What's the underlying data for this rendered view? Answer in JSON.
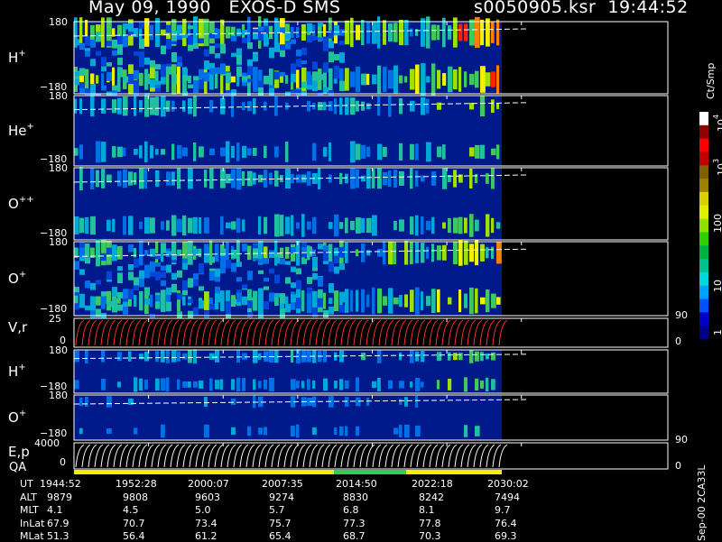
{
  "header": {
    "title": "May 09, 1990   EXOS-D SMS",
    "file": "s0050905.ksr  19:44:52"
  },
  "panels": [
    {
      "name": "h-plus",
      "ion": "H",
      "charge": "+",
      "ymax": "180",
      "ymin": "−180"
    },
    {
      "name": "he-plus",
      "ion": "He",
      "charge": "+",
      "ymax": "180",
      "ymin": "−180"
    },
    {
      "name": "o-plusplus",
      "ion": "O",
      "charge": "++",
      "ymax": "180",
      "ymin": "−180"
    },
    {
      "name": "o-plus",
      "ion": "O",
      "charge": "+",
      "ymax": "180",
      "ymin": "−180"
    },
    {
      "name": "vr",
      "ion": "V,r",
      "charge": "",
      "ymax": "25",
      "ymin": "0"
    },
    {
      "name": "h-plus-2",
      "ion": "H",
      "charge": "+",
      "ymax": "180",
      "ymin": "−180"
    },
    {
      "name": "o-plus-2",
      "ion": "O",
      "charge": "+",
      "ymax": "180",
      "ymin": "−180"
    },
    {
      "name": "ep",
      "ion": "E,p",
      "charge": "",
      "ymax": "4000",
      "ymin": "0"
    }
  ],
  "right_axes": {
    "vr_top": "90",
    "vr_bottom": "0",
    "ep_top": "90",
    "ep_bottom": "0"
  },
  "qa_label": "QA",
  "colorbar": {
    "unit": "Ct/Smp",
    "ticks": [
      "1",
      "10",
      "100",
      "10",
      "10"
    ],
    "tick_exponents": [
      "",
      "",
      "",
      "3",
      "4"
    ],
    "colors": [
      "#000088",
      "#0000c8",
      "#0050ff",
      "#00a0ff",
      "#00d8e0",
      "#00c090",
      "#00b040",
      "#30d000",
      "#90e000",
      "#e0f000",
      "#d8d000",
      "#a08000",
      "#806000",
      "#c00000",
      "#ff0000",
      "#900000",
      "#ffffff"
    ]
  },
  "ephemeris": {
    "rows": [
      {
        "label": "UT",
        "values": [
          "1944:52",
          "1952:28",
          "2000:07",
          "2007:35",
          "2014:50",
          "2022:18",
          "2030:02"
        ]
      },
      {
        "label": "ALT",
        "values": [
          "9879",
          "9808",
          "9603",
          "9274",
          "8830",
          "8242",
          "7494"
        ]
      },
      {
        "label": "MLT",
        "values": [
          "4.1",
          "4.5",
          "5.0",
          "5.7",
          "6.8",
          "8.1",
          "9.7"
        ]
      },
      {
        "label": "InLat",
        "values": [
          "67.9",
          "70.7",
          "73.4",
          "75.7",
          "77.3",
          "77.8",
          "76.4"
        ]
      },
      {
        "label": "MLat",
        "values": [
          "51.3",
          "56.4",
          "61.2",
          "65.4",
          "68.7",
          "70.3",
          "69.3"
        ]
      }
    ]
  },
  "footer_vertical": "Sep-00  2CA33L",
  "chart_data": {
    "type": "heatmap",
    "title": "May 09, 1990   EXOS-D SMS",
    "x": [
      "1944:52",
      "1952:28",
      "2000:07",
      "2007:35",
      "2014:50",
      "2022:18",
      "2030:02"
    ],
    "series": [
      {
        "name": "H+",
        "ylim": [
          -180,
          180
        ]
      },
      {
        "name": "He+",
        "ylim": [
          -180,
          180
        ]
      },
      {
        "name": "O++",
        "ylim": [
          -180,
          180
        ]
      },
      {
        "name": "O+",
        "ylim": [
          -180,
          180
        ]
      },
      {
        "name": "V,r",
        "ylim": [
          0,
          25
        ]
      },
      {
        "name": "H+",
        "ylim": [
          -180,
          180
        ]
      },
      {
        "name": "O+",
        "ylim": [
          -180,
          180
        ]
      },
      {
        "name": "E,p",
        "ylim": [
          0,
          4000
        ]
      }
    ],
    "colorbar_unit": "Ct/Smp",
    "colorbar_range": [
      1,
      10000
    ],
    "colorbar_scale": "log"
  }
}
